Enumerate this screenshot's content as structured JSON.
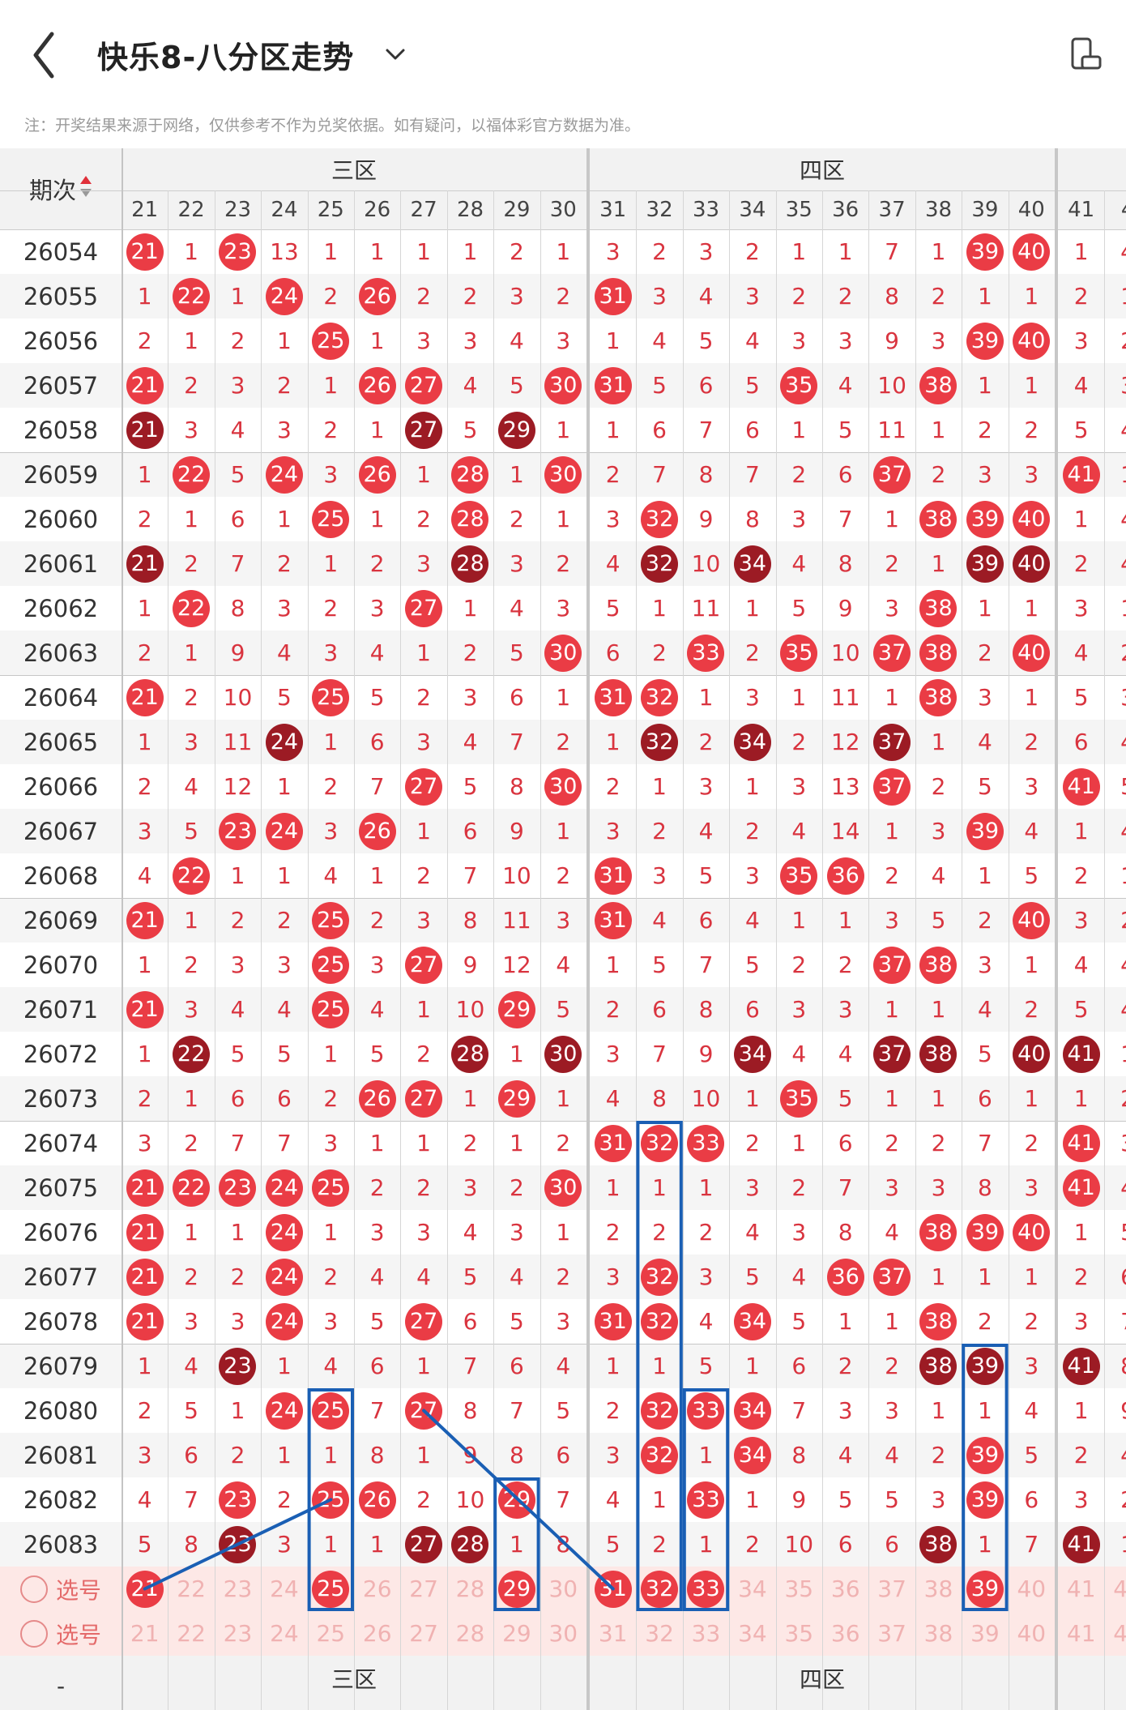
{
  "app": {
    "title": "快乐8-八分区走势",
    "notice": "注：开奖结果来源于网络，仅供参考不作为兑奖依据。如有疑问，以福体彩官方数据为准。",
    "icons": [
      "back-arrow-icon",
      "chevron-down-icon",
      "screen-rotate-icon",
      "sort-icon"
    ]
  },
  "table": {
    "issue_header": "期次",
    "zones": [
      {
        "label": "三区",
        "numbers": [
          21,
          22,
          23,
          24,
          25,
          26,
          27,
          28,
          29,
          30
        ]
      },
      {
        "label": "四区",
        "numbers": [
          31,
          32,
          33,
          34,
          35,
          36,
          37,
          38,
          39,
          40
        ]
      },
      {
        "label": "",
        "numbers": [
          41,
          "4"
        ]
      }
    ],
    "rows": [
      {
        "issue": "26054",
        "cells": [
          "21",
          "1",
          "23",
          "13",
          "1",
          "1",
          "1",
          "1",
          "2",
          "1",
          "3",
          "2",
          "3",
          "2",
          "1",
          "1",
          "7",
          "1",
          "39",
          "40",
          "1",
          "4"
        ]
      },
      {
        "issue": "26055",
        "cells": [
          "1",
          "22",
          "1",
          "24",
          "2",
          "26",
          "2",
          "2",
          "3",
          "2",
          "31",
          "3",
          "4",
          "3",
          "2",
          "2",
          "8",
          "2",
          "1",
          "1",
          "2",
          "1"
        ]
      },
      {
        "issue": "26056",
        "cells": [
          "2",
          "1",
          "2",
          "1",
          "25",
          "1",
          "3",
          "3",
          "4",
          "3",
          "1",
          "4",
          "5",
          "4",
          "3",
          "3",
          "9",
          "3",
          "39",
          "40",
          "3",
          "2"
        ]
      },
      {
        "issue": "26057",
        "cells": [
          "21",
          "2",
          "3",
          "2",
          "1",
          "26",
          "27",
          "4",
          "5",
          "30",
          "31",
          "5",
          "6",
          "5",
          "35",
          "4",
          "10",
          "38",
          "1",
          "1",
          "4",
          "3"
        ]
      },
      {
        "issue": "26058",
        "cells": [
          "21",
          "3",
          "4",
          "3",
          "2",
          "1",
          "27",
          "5",
          "29",
          "1",
          "1",
          "6",
          "7",
          "6",
          "1",
          "5",
          "11",
          "1",
          "2",
          "2",
          "5",
          "4"
        ]
      },
      {
        "issue": "26059",
        "cells": [
          "1",
          "22",
          "5",
          "24",
          "3",
          "26",
          "1",
          "28",
          "1",
          "30",
          "2",
          "7",
          "8",
          "7",
          "2",
          "6",
          "37",
          "2",
          "3",
          "3",
          "41",
          "1"
        ]
      },
      {
        "issue": "26060",
        "cells": [
          "2",
          "1",
          "6",
          "1",
          "25",
          "1",
          "2",
          "28",
          "2",
          "1",
          "3",
          "32",
          "9",
          "8",
          "3",
          "7",
          "1",
          "38",
          "39",
          "40",
          "1",
          "4"
        ]
      },
      {
        "issue": "26061",
        "cells": [
          "21",
          "2",
          "7",
          "2",
          "1",
          "2",
          "3",
          "28",
          "3",
          "2",
          "4",
          "32",
          "10",
          "34",
          "4",
          "8",
          "2",
          "1",
          "39",
          "40",
          "2",
          "4"
        ]
      },
      {
        "issue": "26062",
        "cells": [
          "1",
          "22",
          "8",
          "3",
          "2",
          "3",
          "27",
          "1",
          "4",
          "3",
          "5",
          "1",
          "11",
          "1",
          "5",
          "9",
          "3",
          "38",
          "1",
          "1",
          "3",
          "1"
        ]
      },
      {
        "issue": "26063",
        "cells": [
          "2",
          "1",
          "9",
          "4",
          "3",
          "4",
          "1",
          "2",
          "5",
          "30",
          "6",
          "2",
          "33",
          "2",
          "35",
          "10",
          "37",
          "38",
          "2",
          "40",
          "4",
          "2"
        ]
      },
      {
        "issue": "26064",
        "cells": [
          "21",
          "2",
          "10",
          "5",
          "25",
          "5",
          "2",
          "3",
          "6",
          "1",
          "31",
          "32",
          "1",
          "3",
          "1",
          "11",
          "1",
          "38",
          "3",
          "1",
          "5",
          "3"
        ]
      },
      {
        "issue": "26065",
        "cells": [
          "1",
          "3",
          "11",
          "24",
          "1",
          "6",
          "3",
          "4",
          "7",
          "2",
          "1",
          "32",
          "2",
          "34",
          "2",
          "12",
          "37",
          "1",
          "4",
          "2",
          "6",
          "4"
        ]
      },
      {
        "issue": "26066",
        "cells": [
          "2",
          "4",
          "12",
          "1",
          "2",
          "7",
          "27",
          "5",
          "8",
          "30",
          "2",
          "1",
          "3",
          "1",
          "3",
          "13",
          "37",
          "2",
          "5",
          "3",
          "41",
          "5"
        ]
      },
      {
        "issue": "26067",
        "cells": [
          "3",
          "5",
          "23",
          "24",
          "3",
          "26",
          "1",
          "6",
          "9",
          "1",
          "3",
          "2",
          "4",
          "2",
          "4",
          "14",
          "1",
          "3",
          "39",
          "4",
          "1",
          "4"
        ]
      },
      {
        "issue": "26068",
        "cells": [
          "4",
          "22",
          "1",
          "1",
          "4",
          "1",
          "2",
          "7",
          "10",
          "2",
          "31",
          "3",
          "5",
          "3",
          "35",
          "36",
          "2",
          "4",
          "1",
          "5",
          "2",
          "1"
        ]
      },
      {
        "issue": "26069",
        "cells": [
          "21",
          "1",
          "2",
          "2",
          "25",
          "2",
          "3",
          "8",
          "11",
          "3",
          "31",
          "4",
          "6",
          "4",
          "1",
          "1",
          "3",
          "5",
          "2",
          "40",
          "3",
          "2"
        ]
      },
      {
        "issue": "26070",
        "cells": [
          "1",
          "2",
          "3",
          "3",
          "25",
          "3",
          "27",
          "9",
          "12",
          "4",
          "1",
          "5",
          "7",
          "5",
          "2",
          "2",
          "37",
          "38",
          "3",
          "1",
          "4",
          "4"
        ]
      },
      {
        "issue": "26071",
        "cells": [
          "21",
          "3",
          "4",
          "4",
          "25",
          "4",
          "1",
          "10",
          "29",
          "5",
          "2",
          "6",
          "8",
          "6",
          "3",
          "3",
          "1",
          "1",
          "4",
          "2",
          "5",
          "4"
        ]
      },
      {
        "issue": "26072",
        "cells": [
          "1",
          "22",
          "5",
          "5",
          "1",
          "5",
          "2",
          "28",
          "1",
          "30",
          "3",
          "7",
          "9",
          "34",
          "4",
          "4",
          "37",
          "38",
          "5",
          "40",
          "41",
          "1"
        ]
      },
      {
        "issue": "26073",
        "cells": [
          "2",
          "1",
          "6",
          "6",
          "2",
          "26",
          "27",
          "1",
          "29",
          "1",
          "4",
          "8",
          "10",
          "1",
          "35",
          "5",
          "1",
          "1",
          "6",
          "1",
          "1",
          "2"
        ]
      },
      {
        "issue": "26074",
        "cells": [
          "3",
          "2",
          "7",
          "7",
          "3",
          "1",
          "1",
          "2",
          "1",
          "2",
          "31",
          "32",
          "33",
          "2",
          "1",
          "6",
          "2",
          "2",
          "7",
          "2",
          "41",
          "3"
        ]
      },
      {
        "issue": "26075",
        "cells": [
          "21",
          "22",
          "23",
          "24",
          "25",
          "2",
          "2",
          "3",
          "2",
          "30",
          "1",
          "1",
          "1",
          "3",
          "2",
          "7",
          "3",
          "3",
          "8",
          "3",
          "41",
          "4"
        ]
      },
      {
        "issue": "26076",
        "cells": [
          "21",
          "1",
          "1",
          "24",
          "1",
          "3",
          "3",
          "4",
          "3",
          "1",
          "2",
          "2",
          "2",
          "4",
          "3",
          "8",
          "4",
          "38",
          "39",
          "40",
          "1",
          "5"
        ]
      },
      {
        "issue": "26077",
        "cells": [
          "21",
          "2",
          "2",
          "24",
          "2",
          "4",
          "4",
          "5",
          "4",
          "2",
          "3",
          "32",
          "3",
          "5",
          "4",
          "36",
          "37",
          "1",
          "1",
          "1",
          "2",
          "6"
        ]
      },
      {
        "issue": "26078",
        "cells": [
          "21",
          "3",
          "3",
          "24",
          "3",
          "5",
          "27",
          "6",
          "5",
          "3",
          "31",
          "32",
          "4",
          "34",
          "5",
          "1",
          "1",
          "38",
          "2",
          "2",
          "3",
          "7"
        ]
      },
      {
        "issue": "26079",
        "cells": [
          "1",
          "4",
          "23",
          "1",
          "4",
          "6",
          "1",
          "7",
          "6",
          "4",
          "1",
          "1",
          "5",
          "1",
          "6",
          "2",
          "2",
          "38",
          "39",
          "3",
          "41",
          "8"
        ]
      },
      {
        "issue": "26080",
        "cells": [
          "2",
          "5",
          "1",
          "24",
          "25",
          "7",
          "27",
          "8",
          "7",
          "5",
          "2",
          "32",
          "33",
          "34",
          "7",
          "3",
          "3",
          "1",
          "1",
          "4",
          "1",
          "9"
        ]
      },
      {
        "issue": "26081",
        "cells": [
          "3",
          "6",
          "2",
          "1",
          "1",
          "8",
          "1",
          "9",
          "8",
          "6",
          "3",
          "32",
          "1",
          "34",
          "8",
          "4",
          "4",
          "2",
          "39",
          "5",
          "2",
          "4"
        ]
      },
      {
        "issue": "26082",
        "cells": [
          "4",
          "7",
          "23",
          "2",
          "25",
          "26",
          "2",
          "10",
          "29",
          "7",
          "4",
          "1",
          "33",
          "1",
          "9",
          "5",
          "5",
          "3",
          "39",
          "6",
          "3",
          "2"
        ]
      },
      {
        "issue": "26083",
        "cells": [
          "5",
          "8",
          "23",
          "3",
          "1",
          "1",
          "27",
          "28",
          "1",
          "8",
          "5",
          "2",
          "1",
          "2",
          "10",
          "6",
          "6",
          "38",
          "1",
          "7",
          "41",
          "1"
        ]
      }
    ],
    "select_rows": [
      {
        "label": "选号",
        "picked": [
          "21",
          "25",
          "29",
          "31",
          "32",
          "33",
          "39"
        ]
      },
      {
        "label": "选号",
        "picked": []
      }
    ],
    "footer_issue": "-",
    "colors": {
      "hit": "#ea3c45",
      "hit_dark": "#9c1b24",
      "miss_text": "#d9343f",
      "pick_bg": "#fde8e6",
      "stripe": "#f5f5f5",
      "highlight_box": "#1a5fb4",
      "zone_bg": "#f6e8e8"
    }
  }
}
